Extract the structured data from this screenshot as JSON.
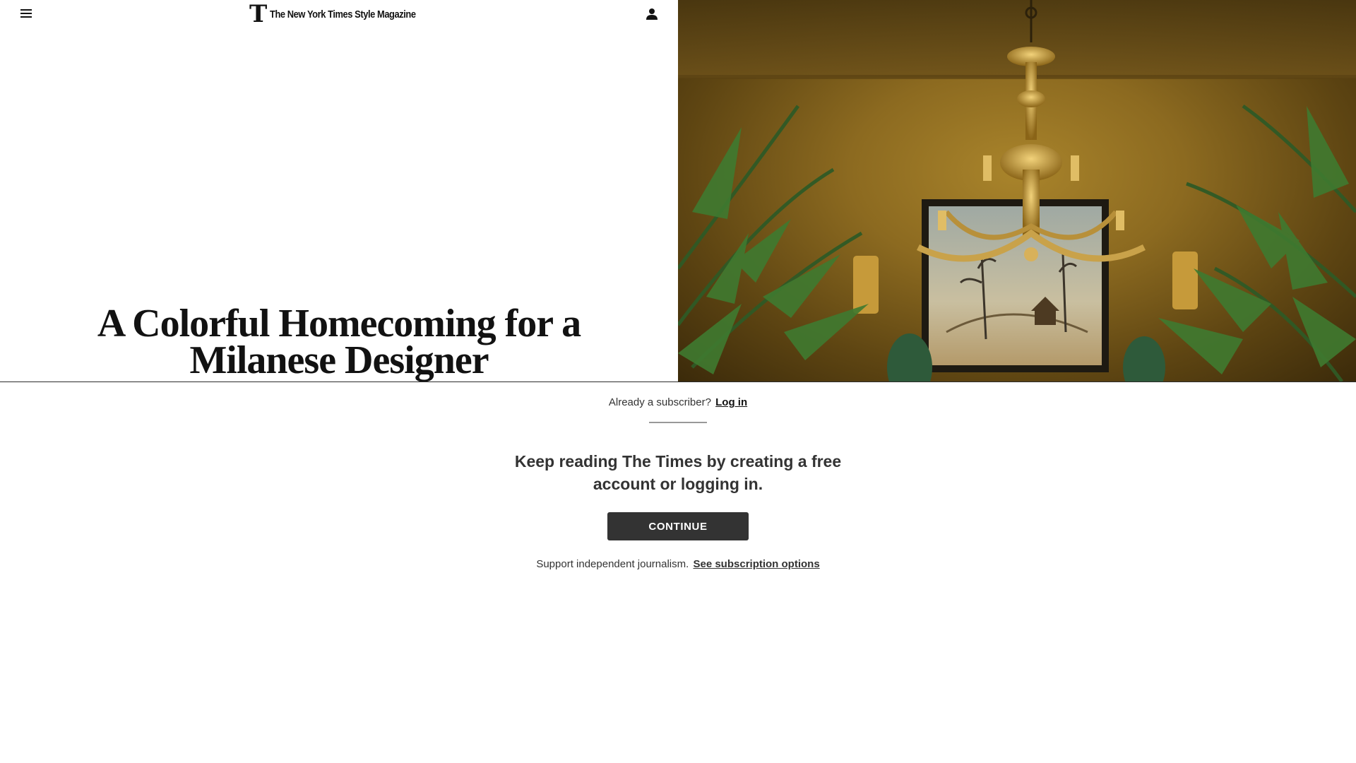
{
  "masthead": {
    "menu_icon": "hamburger-menu-icon",
    "logo_mark": "T",
    "logo_text": "The New York Times Style Magazine",
    "account_icon": "person-icon"
  },
  "article": {
    "headline_line1": "A Colorful Homecoming for a",
    "headline_line2": "Milanese Designer",
    "hero_image_subject": "gilded chandelier, framed chinoiserie painting, palm fronds, ochre wall"
  },
  "gate": {
    "subscriber_prompt": "Already a subscriber?",
    "login_label": "Log in",
    "heading": "Keep reading The Times by creating a free account or logging in.",
    "continue_label": "CONTINUE",
    "support_text": "Support independent journalism.",
    "subscription_link": "See subscription options"
  },
  "colors": {
    "button_bg": "#333333",
    "text": "#121212",
    "wall_ochre": "#8c6a20"
  }
}
